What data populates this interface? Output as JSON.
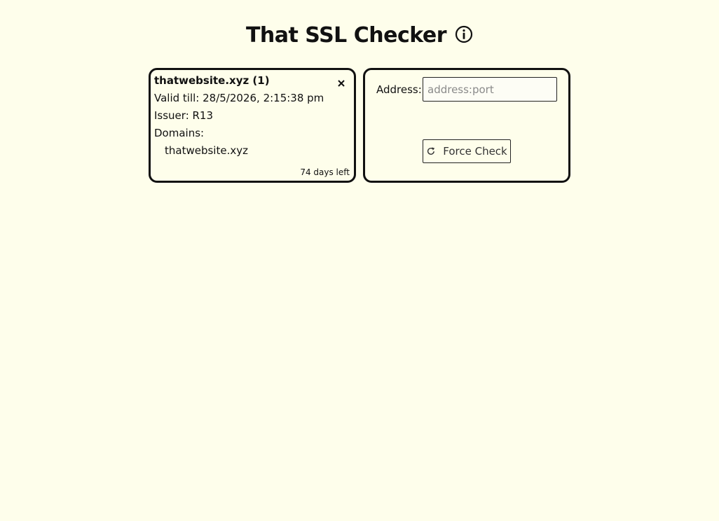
{
  "header": {
    "title": "That SSL Checker",
    "info_icon": "info-circle-icon"
  },
  "certificate": {
    "title": "thatwebsite.xyz (1)",
    "valid_till": "Valid till: 28/5/2026, 2:15:38 pm",
    "issuer": "Issuer: R13",
    "domains_label": "Domains:",
    "domains": [
      "thatwebsite.xyz"
    ],
    "days_left": "74 days left",
    "close_icon": "close-icon"
  },
  "checker": {
    "address_label": "Address:",
    "address_value": "",
    "address_placeholder": "address:port",
    "force_check_label": "Force Check",
    "refresh_icon": "refresh-icon"
  },
  "colors": {
    "background": "#fefeeb",
    "border": "#111111",
    "text": "#111111",
    "placeholder": "#8a8a8a"
  }
}
